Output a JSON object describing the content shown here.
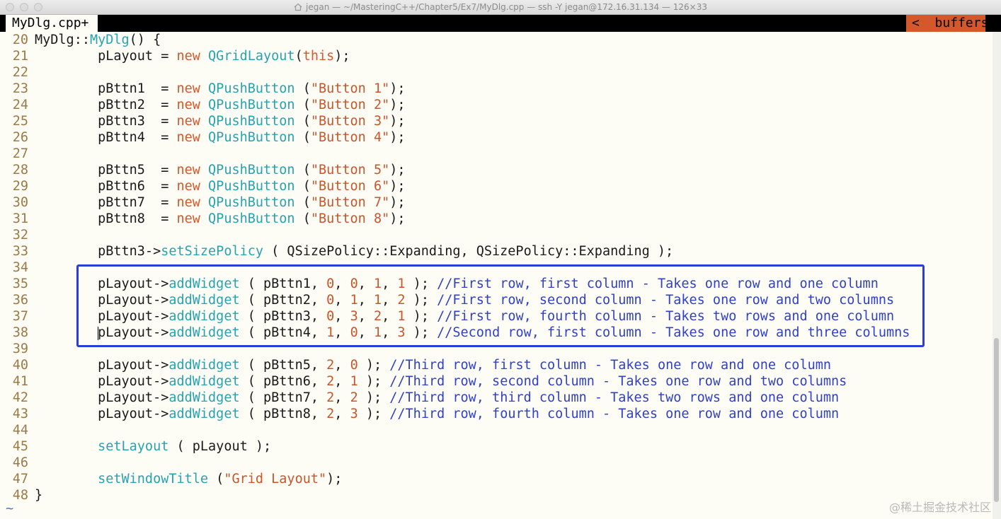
{
  "window": {
    "title": "jegan — ~/MasteringC++/Chapter5/Ex7/MyDlg.cpp — ssh -Y jegan@172.16.31.134 — 126×33"
  },
  "tabline": {
    "active_tab": "MyDlg.cpp+",
    "buffers_label": "<  buffers"
  },
  "watermark": "@稀土掘金技术社区",
  "colors": {
    "keyword": "#d4582a",
    "type": "#26a3b0",
    "string": "#c8552b",
    "comment": "#3040c8",
    "line_number": "#9a7a46",
    "highlight_box": "#2b3fd6",
    "background": "#fdfdf6"
  },
  "editor": {
    "lines": [
      {
        "n": "20",
        "tokens": [
          [
            "p",
            "MyDlg::"
          ],
          [
            "ty",
            "MyDlg"
          ],
          [
            "p",
            "() {"
          ]
        ]
      },
      {
        "n": "21",
        "tokens": [
          [
            "p",
            "        pLayout = "
          ],
          [
            "kw",
            "new"
          ],
          [
            "p",
            " "
          ],
          [
            "ty",
            "QGridLayout"
          ],
          [
            "p",
            "("
          ],
          [
            "kw",
            "this"
          ],
          [
            "p",
            ");"
          ]
        ]
      },
      {
        "n": "22",
        "tokens": []
      },
      {
        "n": "23",
        "tokens": [
          [
            "p",
            "        pBttn1  = "
          ],
          [
            "kw",
            "new"
          ],
          [
            "p",
            " "
          ],
          [
            "ty",
            "QPushButton"
          ],
          [
            "p",
            " ("
          ],
          [
            "str",
            "\"Button 1\""
          ],
          [
            "p",
            ");"
          ]
        ]
      },
      {
        "n": "24",
        "tokens": [
          [
            "p",
            "        pBttn2  = "
          ],
          [
            "kw",
            "new"
          ],
          [
            "p",
            " "
          ],
          [
            "ty",
            "QPushButton"
          ],
          [
            "p",
            " ("
          ],
          [
            "str",
            "\"Button 2\""
          ],
          [
            "p",
            ");"
          ]
        ]
      },
      {
        "n": "25",
        "tokens": [
          [
            "p",
            "        pBttn3  = "
          ],
          [
            "kw",
            "new"
          ],
          [
            "p",
            " "
          ],
          [
            "ty",
            "QPushButton"
          ],
          [
            "p",
            " ("
          ],
          [
            "str",
            "\"Button 3\""
          ],
          [
            "p",
            ");"
          ]
        ]
      },
      {
        "n": "26",
        "tokens": [
          [
            "p",
            "        pBttn4  = "
          ],
          [
            "kw",
            "new"
          ],
          [
            "p",
            " "
          ],
          [
            "ty",
            "QPushButton"
          ],
          [
            "p",
            " ("
          ],
          [
            "str",
            "\"Button 4\""
          ],
          [
            "p",
            ");"
          ]
        ]
      },
      {
        "n": "27",
        "tokens": []
      },
      {
        "n": "28",
        "tokens": [
          [
            "p",
            "        pBttn5  = "
          ],
          [
            "kw",
            "new"
          ],
          [
            "p",
            " "
          ],
          [
            "ty",
            "QPushButton"
          ],
          [
            "p",
            " ("
          ],
          [
            "str",
            "\"Button 5\""
          ],
          [
            "p",
            ");"
          ]
        ]
      },
      {
        "n": "29",
        "tokens": [
          [
            "p",
            "        pBttn6  = "
          ],
          [
            "kw",
            "new"
          ],
          [
            "p",
            " "
          ],
          [
            "ty",
            "QPushButton"
          ],
          [
            "p",
            " ("
          ],
          [
            "str",
            "\"Button 6\""
          ],
          [
            "p",
            ");"
          ]
        ]
      },
      {
        "n": "30",
        "tokens": [
          [
            "p",
            "        pBttn7  = "
          ],
          [
            "kw",
            "new"
          ],
          [
            "p",
            " "
          ],
          [
            "ty",
            "QPushButton"
          ],
          [
            "p",
            " ("
          ],
          [
            "str",
            "\"Button 7\""
          ],
          [
            "p",
            ");"
          ]
        ]
      },
      {
        "n": "31",
        "tokens": [
          [
            "p",
            "        pBttn8  = "
          ],
          [
            "kw",
            "new"
          ],
          [
            "p",
            " "
          ],
          [
            "ty",
            "QPushButton"
          ],
          [
            "p",
            " ("
          ],
          [
            "str",
            "\"Button 8\""
          ],
          [
            "p",
            ");"
          ]
        ]
      },
      {
        "n": "32",
        "tokens": []
      },
      {
        "n": "33",
        "tokens": [
          [
            "p",
            "        pBttn3->"
          ],
          [
            "ty",
            "setSizePolicy"
          ],
          [
            "p",
            " ( QSizePolicy::Expanding, QSizePolicy::Expanding );"
          ]
        ]
      },
      {
        "n": "34",
        "tokens": []
      },
      {
        "n": "35",
        "tokens": [
          [
            "p",
            "        pLayout->"
          ],
          [
            "ty",
            "addWidget"
          ],
          [
            "p",
            " ( pBttn1, "
          ],
          [
            "num",
            "0"
          ],
          [
            "p",
            ", "
          ],
          [
            "num",
            "0"
          ],
          [
            "p",
            ", "
          ],
          [
            "num",
            "1"
          ],
          [
            "p",
            ", "
          ],
          [
            "num",
            "1"
          ],
          [
            "p",
            " ); "
          ],
          [
            "cm",
            "//First row, first column - Takes one row and one column"
          ]
        ]
      },
      {
        "n": "36",
        "tokens": [
          [
            "p",
            "        pLayout->"
          ],
          [
            "ty",
            "addWidget"
          ],
          [
            "p",
            " ( pBttn2, "
          ],
          [
            "num",
            "0"
          ],
          [
            "p",
            ", "
          ],
          [
            "num",
            "1"
          ],
          [
            "p",
            ", "
          ],
          [
            "num",
            "1"
          ],
          [
            "p",
            ", "
          ],
          [
            "num",
            "2"
          ],
          [
            "p",
            " ); "
          ],
          [
            "cm",
            "//First row, second column - Takes one row and two columns"
          ]
        ]
      },
      {
        "n": "37",
        "tokens": [
          [
            "p",
            "        pLayout->"
          ],
          [
            "ty",
            "addWidget"
          ],
          [
            "p",
            " ( pBttn3, "
          ],
          [
            "num",
            "0"
          ],
          [
            "p",
            ", "
          ],
          [
            "num",
            "3"
          ],
          [
            "p",
            ", "
          ],
          [
            "num",
            "2"
          ],
          [
            "p",
            ", "
          ],
          [
            "num",
            "1"
          ],
          [
            "p",
            " ); "
          ],
          [
            "cm",
            "//First row, fourth column - Takes two rows and one column"
          ]
        ]
      },
      {
        "n": "38",
        "cursor": true,
        "tokens": [
          [
            "p",
            "        pLayout->"
          ],
          [
            "ty",
            "addWidget"
          ],
          [
            "p",
            " ( pBttn4, "
          ],
          [
            "num",
            "1"
          ],
          [
            "p",
            ", "
          ],
          [
            "num",
            "0"
          ],
          [
            "p",
            ", "
          ],
          [
            "num",
            "1"
          ],
          [
            "p",
            ", "
          ],
          [
            "num",
            "3"
          ],
          [
            "p",
            " ); "
          ],
          [
            "cm",
            "//Second row, first column - Takes one row and three columns"
          ]
        ]
      },
      {
        "n": "39",
        "tokens": []
      },
      {
        "n": "40",
        "tokens": [
          [
            "p",
            "        pLayout->"
          ],
          [
            "ty",
            "addWidget"
          ],
          [
            "p",
            " ( pBttn5, "
          ],
          [
            "num",
            "2"
          ],
          [
            "p",
            ", "
          ],
          [
            "num",
            "0"
          ],
          [
            "p",
            " ); "
          ],
          [
            "cm",
            "//Third row, first column - Takes one row and one column"
          ]
        ]
      },
      {
        "n": "41",
        "tokens": [
          [
            "p",
            "        pLayout->"
          ],
          [
            "ty",
            "addWidget"
          ],
          [
            "p",
            " ( pBttn6, "
          ],
          [
            "num",
            "2"
          ],
          [
            "p",
            ", "
          ],
          [
            "num",
            "1"
          ],
          [
            "p",
            " ); "
          ],
          [
            "cm",
            "//Third row, second column - Takes one row and two columns"
          ]
        ]
      },
      {
        "n": "42",
        "tokens": [
          [
            "p",
            "        pLayout->"
          ],
          [
            "ty",
            "addWidget"
          ],
          [
            "p",
            " ( pBttn7, "
          ],
          [
            "num",
            "2"
          ],
          [
            "p",
            ", "
          ],
          [
            "num",
            "2"
          ],
          [
            "p",
            " ); "
          ],
          [
            "cm",
            "//Third row, third column - Takes two rows and one column"
          ]
        ]
      },
      {
        "n": "43",
        "tokens": [
          [
            "p",
            "        pLayout->"
          ],
          [
            "ty",
            "addWidget"
          ],
          [
            "p",
            " ( pBttn8, "
          ],
          [
            "num",
            "2"
          ],
          [
            "p",
            ", "
          ],
          [
            "num",
            "3"
          ],
          [
            "p",
            " ); "
          ],
          [
            "cm",
            "//Third row, fourth column - Takes one row and one column"
          ]
        ]
      },
      {
        "n": "44",
        "tokens": []
      },
      {
        "n": "45",
        "tokens": [
          [
            "p",
            "        "
          ],
          [
            "ty",
            "setLayout"
          ],
          [
            "p",
            " ( pLayout );"
          ]
        ]
      },
      {
        "n": "46",
        "tokens": []
      },
      {
        "n": "47",
        "tokens": [
          [
            "p",
            "        "
          ],
          [
            "ty",
            "setWindowTitle"
          ],
          [
            "p",
            " ("
          ],
          [
            "str",
            "\"Grid Layout\""
          ],
          [
            "p",
            ");"
          ]
        ]
      },
      {
        "n": "48",
        "tokens": [
          [
            "p",
            "}"
          ]
        ]
      }
    ],
    "end_marker": "~"
  }
}
